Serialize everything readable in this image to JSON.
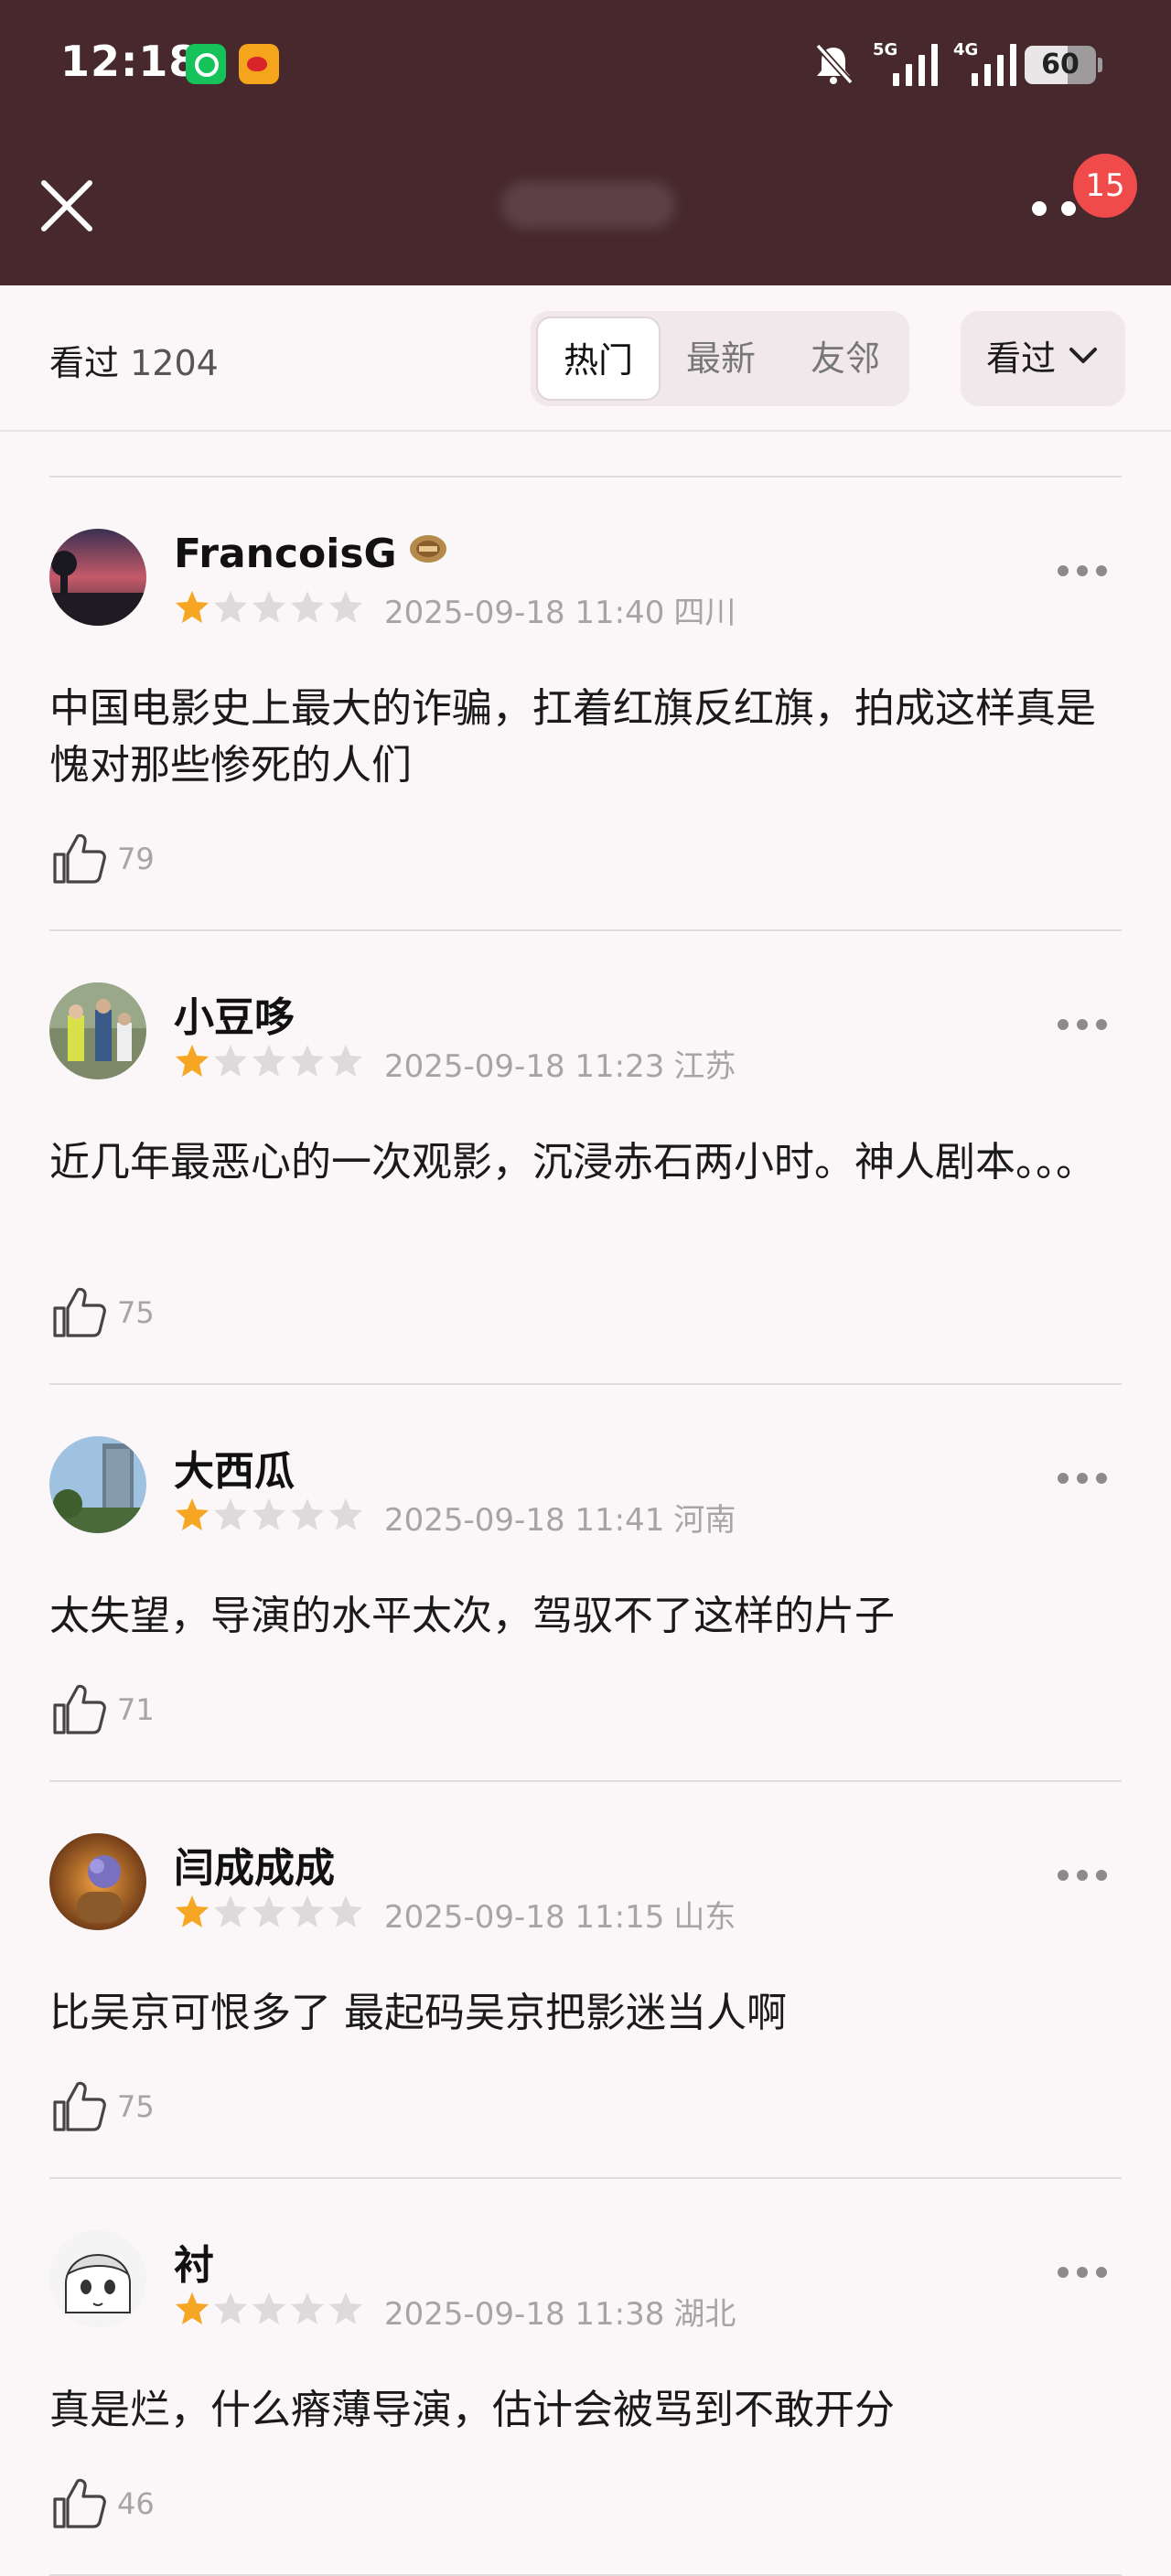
{
  "status_bar": {
    "time": "12:18",
    "network_1": "5G",
    "network_2": "4G",
    "battery": "60"
  },
  "header": {
    "badge_count": "15"
  },
  "filter_bar": {
    "count_label": "看过",
    "count_value": "1204",
    "tabs": [
      {
        "label": "热门",
        "active": true
      },
      {
        "label": "最新",
        "active": false
      },
      {
        "label": "友邻",
        "active": false
      }
    ],
    "sort_label": "看过"
  },
  "reviews": [
    {
      "username": "FrancoisG",
      "has_medal": true,
      "rating": 1,
      "datetime": "2025-09-18 11:40",
      "location": "四川",
      "text": "中国电影史上最大的诈骗，扛着红旗反红旗，拍成这样真是愧对那些惨死的人们",
      "likes": "79"
    },
    {
      "username": "小豆哆",
      "has_medal": false,
      "rating": 1,
      "datetime": "2025-09-18 11:23",
      "location": "江苏",
      "text": "近几年最恶心的一次观影，沉浸赤石两小时。神人剧本。。。",
      "likes": "75"
    },
    {
      "username": "大西瓜",
      "has_medal": false,
      "rating": 1,
      "datetime": "2025-09-18 11:41",
      "location": "河南",
      "text": "太失望，导演的水平太次，驾驭不了这样的片子",
      "likes": "71"
    },
    {
      "username": "闫成成成",
      "has_medal": false,
      "rating": 1,
      "datetime": "2025-09-18 11:15",
      "location": "山东",
      "text": "比吴京可恨多了 最起码吴京把影迷当人啊",
      "likes": "75"
    },
    {
      "username": "衬",
      "has_medal": false,
      "rating": 1,
      "datetime": "2025-09-18 11:38",
      "location": "湖北",
      "text": "真是烂，什么瘠薄导演，估计会被骂到不敢开分",
      "likes": "46"
    }
  ],
  "colors": {
    "header_bg": "#46282d",
    "page_bg": "#fbf6f8",
    "star_on": "#f5a623",
    "star_off": "#dcdadb",
    "badge": "#ef4b4b"
  }
}
